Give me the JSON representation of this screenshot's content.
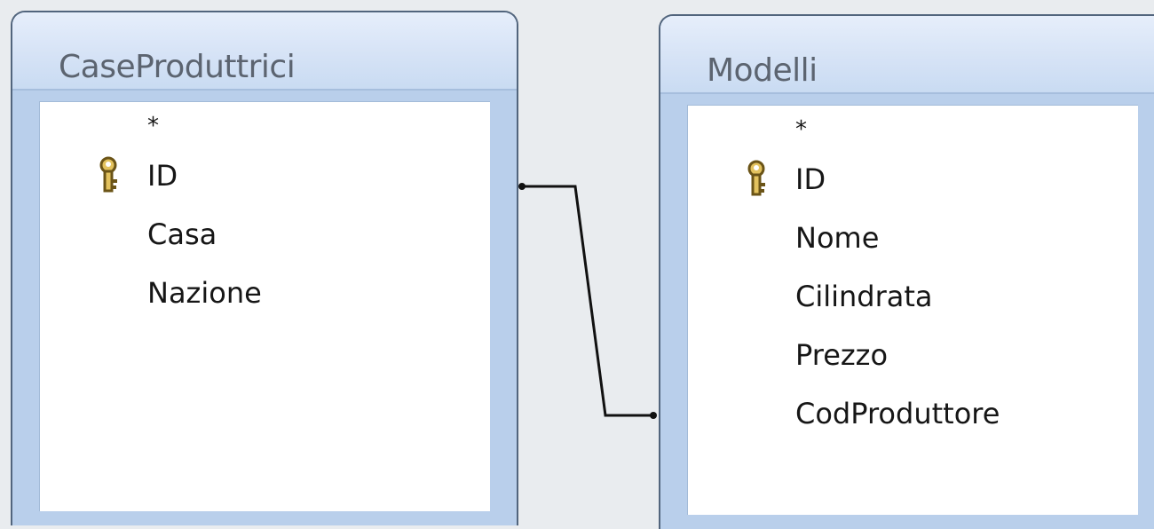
{
  "tables": [
    {
      "title": "CaseProduttrici",
      "fields": [
        {
          "name": "*",
          "primary_key": false
        },
        {
          "name": "ID",
          "primary_key": true
        },
        {
          "name": "Casa",
          "primary_key": false
        },
        {
          "name": "Nazione",
          "primary_key": false
        }
      ]
    },
    {
      "title": "Modelli",
      "fields": [
        {
          "name": "*",
          "primary_key": false
        },
        {
          "name": "ID",
          "primary_key": true
        },
        {
          "name": "Nome",
          "primary_key": false
        },
        {
          "name": "Cilindrata",
          "primary_key": false
        },
        {
          "name": "Prezzo",
          "primary_key": false
        },
        {
          "name": "CodProduttore",
          "primary_key": false
        }
      ]
    }
  ],
  "relationship": {
    "from_table": "CaseProduttrici",
    "from_field": "ID",
    "to_table": "Modelli",
    "to_field": "CodProduttore"
  },
  "colors": {
    "window_border": "#52657d",
    "title_text": "#5c6470",
    "frame": "#b9cfeb",
    "key_icon": "#d4b04a"
  }
}
